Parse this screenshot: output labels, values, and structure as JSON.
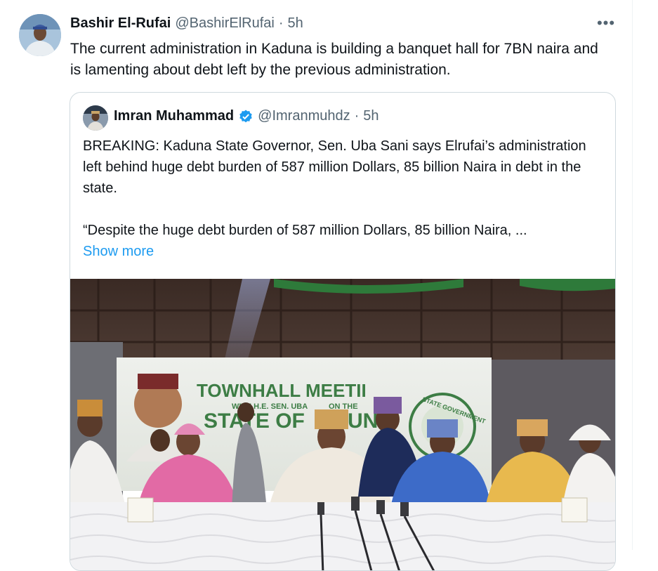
{
  "tweet": {
    "author_name": "Bashir El-Rufai",
    "author_handle": "@BashirElRufai",
    "separator": "·",
    "time": "5h",
    "more_icon": "more-horizontal-icon",
    "text": "The current administration in Kaduna is building a banquet hall for 7BN naira and is lamenting about debt left by the previous administration."
  },
  "quote": {
    "author_name": "Imran Muhammad",
    "verified_icon": "verified-badge-icon",
    "author_handle": "@Imranmuhdz",
    "separator": "·",
    "time": "5h",
    "text_para1": "BREAKING: Kaduna State Governor, Sen. Uba Sani says Elrufai’s administration left behind huge debt burden of 587 million Dollars, 85 billion Naira in debt in the state.",
    "text_para2": "“Despite the huge debt burden of 587 million Dollars, 85 billion Naira, ...",
    "show_more": "Show more",
    "image": {
      "banner_line1": "TOWNHALL MEETII",
      "banner_line2": "WITH H.E. SEN. UBA",
      "banner_line3": "ON THE",
      "banner_line4": "STATE OF",
      "banner_line5": "UNA",
      "seal_text": "STATE GOVERNMENT"
    }
  },
  "colors": {
    "text_primary": "#0f1419",
    "text_secondary": "#536471",
    "link": "#1d9bf0",
    "border": "#cfd9de",
    "verified": "#1d9bf0"
  }
}
